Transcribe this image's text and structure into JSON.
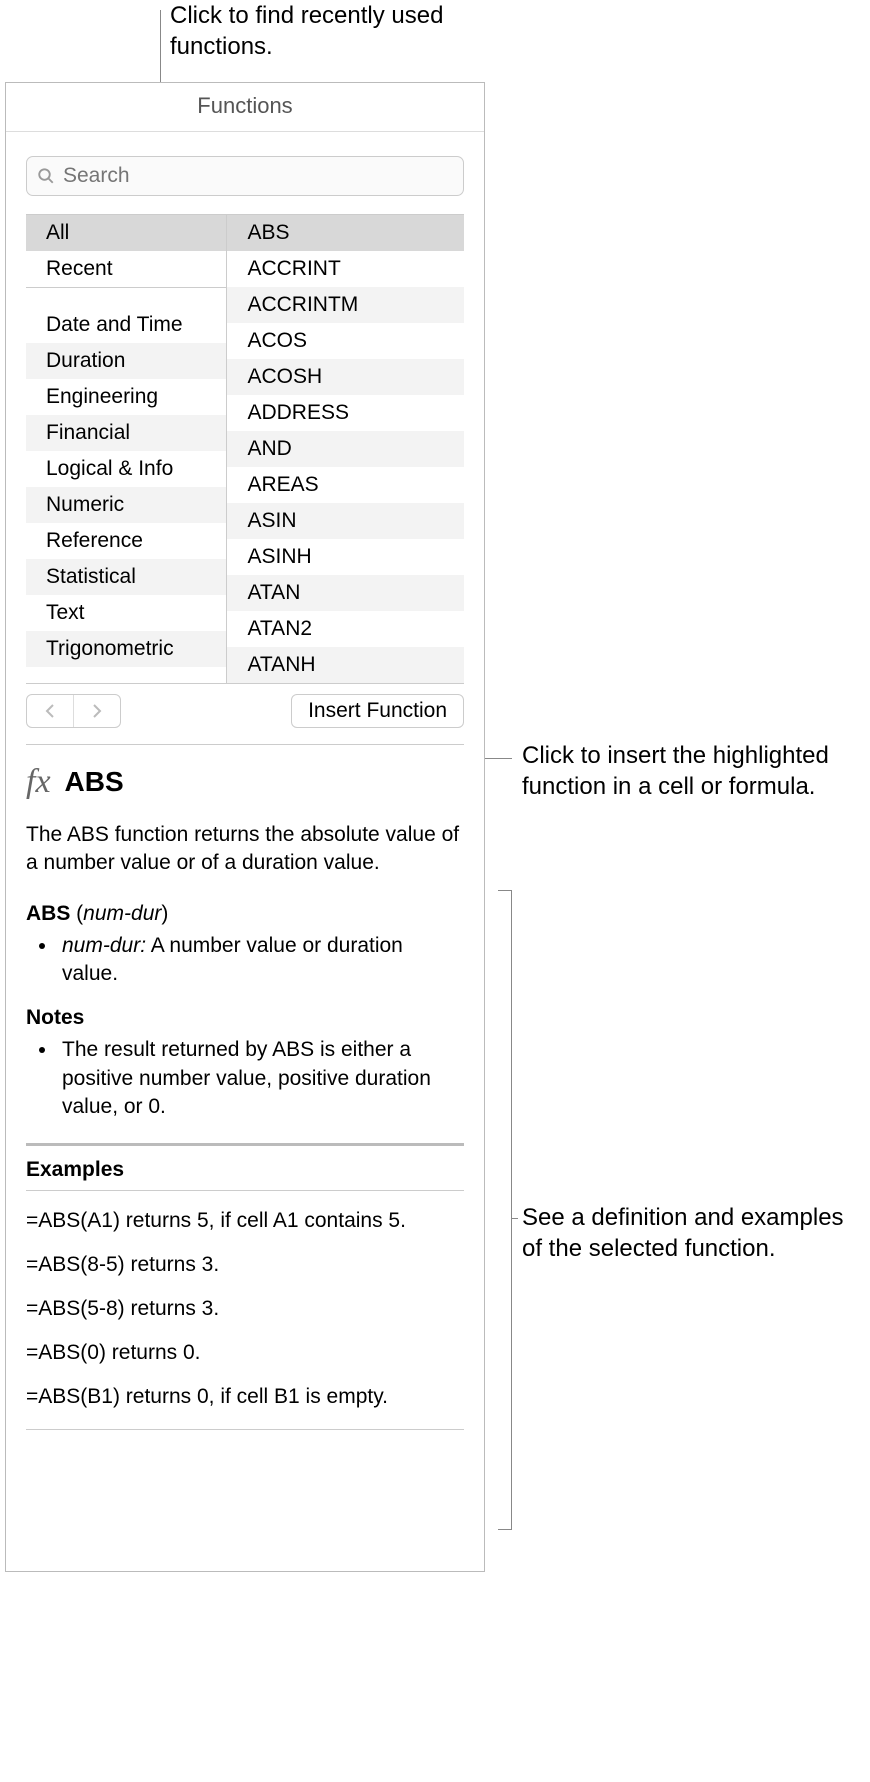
{
  "callouts": {
    "top": "Click to find recently used functions.",
    "insert": "Click to insert the highlighted function in a cell or formula.",
    "detail": "See a definition and examples of the selected function."
  },
  "panel": {
    "title": "Functions",
    "search_placeholder": "Search"
  },
  "categories": [
    "All",
    "Recent",
    "",
    "Date and Time",
    "Duration",
    "Engineering",
    "Financial",
    "Logical & Info",
    "Numeric",
    "Reference",
    "Statistical",
    "Text",
    "Trigonometric"
  ],
  "functions": [
    "ABS",
    "ACCRINT",
    "ACCRINTM",
    "ACOS",
    "ACOSH",
    "ADDRESS",
    "AND",
    "AREAS",
    "ASIN",
    "ASINH",
    "ATAN",
    "ATAN2",
    "ATANH"
  ],
  "toolbar": {
    "insert_label": "Insert Function"
  },
  "detail": {
    "fx": "fx",
    "name": "ABS",
    "description": "The ABS function returns the absolute value of a number value or of a duration value.",
    "syntax_name": "ABS",
    "syntax_args": "num-dur",
    "arg_name": "num-dur:",
    "arg_desc": " A number value or duration value.",
    "notes_heading": "Notes",
    "note1": "The result returned by ABS is either a positive number value, positive duration value, or 0.",
    "examples_heading": "Examples",
    "examples": [
      "=ABS(A1) returns 5, if cell A1 contains 5.",
      "=ABS(8-5) returns 3.",
      "=ABS(5-8) returns 3.",
      "=ABS(0) returns 0.",
      "=ABS(B1) returns 0, if cell B1 is empty."
    ]
  }
}
